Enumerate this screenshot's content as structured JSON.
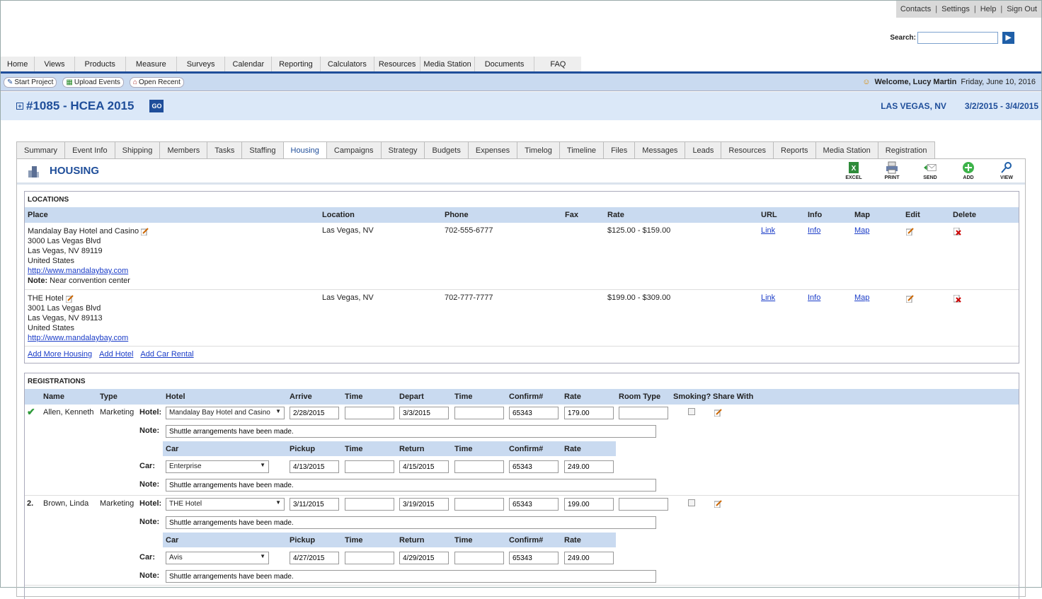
{
  "top_links": [
    "Contacts",
    "Settings",
    "Help",
    "Sign Out"
  ],
  "search": {
    "label": "Search:",
    "value": ""
  },
  "main_nav": [
    "Home",
    "Views",
    "Products",
    "Measure",
    "Surveys",
    "Calendar",
    "Reporting",
    "Calculators",
    "Resources",
    "Media Station",
    "Documents",
    "FAQ"
  ],
  "toolbar": {
    "start_project": "Start Project",
    "upload_events": "Upload Events",
    "open_recent": "Open Recent",
    "welcome": "Welcome, Lucy Martin",
    "date": "Friday, June 10, 2016"
  },
  "project": {
    "expand": "+",
    "title": "#1085 - HCEA 2015",
    "go": "GO",
    "location": "LAS VEGAS, NV",
    "dates": "3/2/2015 - 3/4/2015"
  },
  "tabs": [
    "Summary",
    "Event Info",
    "Shipping",
    "Members",
    "Tasks",
    "Staffing",
    "Housing",
    "Campaigns",
    "Strategy",
    "Budgets",
    "Expenses",
    "Timelog",
    "Timeline",
    "Files",
    "Messages",
    "Leads",
    "Resources",
    "Reports",
    "Media Station",
    "Registration"
  ],
  "active_tab": "Housing",
  "panel": {
    "title": "HOUSING",
    "actions": [
      "EXCEL",
      "PRINT",
      "SEND",
      "ADD",
      "VIEW"
    ]
  },
  "locations": {
    "title": "LOCATIONS",
    "columns": [
      "Place",
      "Location",
      "Phone",
      "Fax",
      "Rate",
      "URL",
      "Info",
      "Map",
      "Edit",
      "Delete"
    ],
    "rows": [
      {
        "name": "Mandalay Bay Hotel and Casino",
        "addr1": "3000 Las Vegas Blvd",
        "addr2": "Las Vegas, NV  89119",
        "country": "United States",
        "url": "http://www.mandalaybay.com",
        "note_label": "Note:",
        "note": "Near convention center",
        "location": "Las Vegas, NV",
        "phone": "702-555-6777",
        "fax": "",
        "rate": "$125.00 - $159.00",
        "link": "Link",
        "info": "Info",
        "map": "Map"
      },
      {
        "name": "THE Hotel",
        "addr1": "3001 Las Vegas Blvd",
        "addr2": "Las Vegas, NV  89113",
        "country": "United States",
        "url": "http://www.mandalaybay.com",
        "note_label": "",
        "note": "",
        "location": "Las Vegas, NV",
        "phone": "702-777-7777",
        "fax": "",
        "rate": "$199.00 - $309.00",
        "link": "Link",
        "info": "Info",
        "map": "Map"
      }
    ],
    "links": [
      "Add More Housing",
      "Add Hotel",
      "Add Car Rental"
    ]
  },
  "registrations": {
    "title": "REGISTRATIONS",
    "columns": [
      "Name",
      "Type",
      "Hotel",
      "Arrive",
      "Time",
      "Depart",
      "Time",
      "Confirm#",
      "Rate",
      "Room Type",
      "Smoking?",
      "Share With"
    ],
    "car_columns": [
      "Car",
      "Pickup",
      "Time",
      "Return",
      "Time",
      "Confirm#",
      "Rate"
    ],
    "labels": {
      "hotel": "Hotel:",
      "note": "Note:",
      "car": "Car:"
    },
    "rows": [
      {
        "marker": "✔",
        "name": "Allen, Kenneth",
        "type": "Marketing",
        "hotel": "Mandalay Bay Hotel and Casino",
        "arrive": "2/28/2015",
        "arrive_time": "",
        "depart": "3/3/2015",
        "depart_time": "",
        "confirm": "65343",
        "rate": "179.00",
        "room_type": "",
        "note": "Shuttle arrangements have been made.",
        "car": "Enterprise",
        "pickup": "4/13/2015",
        "pickup_time": "",
        "return": "4/15/2015",
        "return_time": "",
        "car_confirm": "65343",
        "car_rate": "249.00",
        "car_note": "Shuttle arrangements have been made."
      },
      {
        "marker": "2.",
        "name": "Brown, Linda",
        "type": "Marketing",
        "hotel": "THE Hotel",
        "arrive": "3/11/2015",
        "arrive_time": "",
        "depart": "3/19/2015",
        "depart_time": "",
        "confirm": "65343",
        "rate": "199.00",
        "room_type": "",
        "note": "Shuttle arrangements have been made.",
        "car": "Avis",
        "pickup": "4/27/2015",
        "pickup_time": "",
        "return": "4/29/2015",
        "return_time": "",
        "car_confirm": "65343",
        "car_rate": "249.00",
        "car_note": "Shuttle arrangements have been made."
      }
    ]
  }
}
